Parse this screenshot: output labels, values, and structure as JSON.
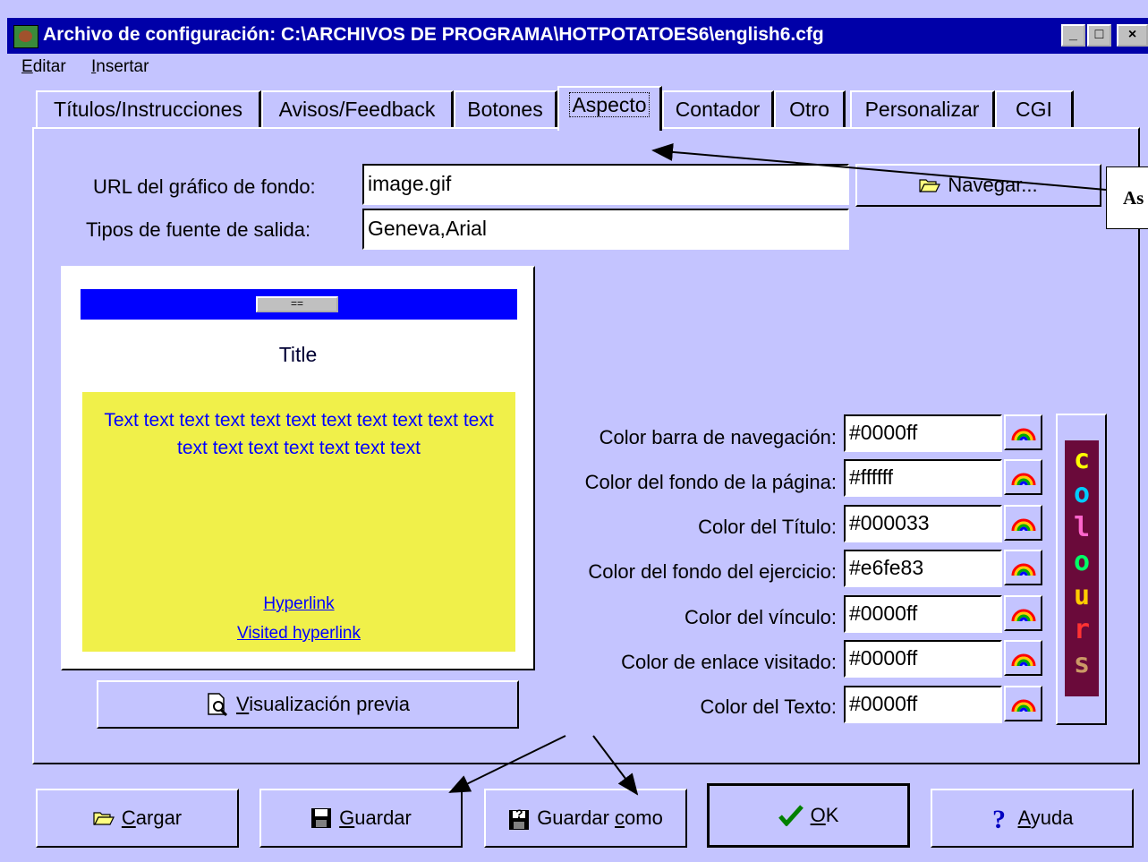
{
  "window": {
    "title": "Archivo de configuración: C:\\ARCHIVOS DE PROGRAMA\\HOTPOTATOES6\\english6.cfg",
    "minimize": "_",
    "maximize": "□",
    "close": "×"
  },
  "menu": {
    "editar_first": "E",
    "editar_rest": "ditar",
    "insertar_first": "I",
    "insertar_rest": "nsertar"
  },
  "tabs": [
    {
      "label": "Títulos/Instrucciones"
    },
    {
      "label": "Avisos/Feedback"
    },
    {
      "label": "Botones"
    },
    {
      "label": "Aspecto"
    },
    {
      "label": "Contador"
    },
    {
      "label": "Otro"
    },
    {
      "label": "Personalizar"
    },
    {
      "label": "CGI"
    }
  ],
  "form": {
    "bg_url_label": "URL del gráfico de fondo:",
    "bg_url_value": "image.gif",
    "browse_label": "Navegar...",
    "font_label": "Tipos de fuente de salida:",
    "font_value": "Geneva,Arial"
  },
  "preview": {
    "nav_button": "==",
    "title": "Title",
    "text": "Text text text text text text text text text text text text text text text text text text",
    "hyperlink": "Hyperlink",
    "visited": "Visited hyperlink",
    "button_first": "V",
    "button_rest": "isualización previa"
  },
  "colors": [
    {
      "label": "Color barra de navegación:",
      "value": "#0000ff"
    },
    {
      "label": "Color del fondo de la página:",
      "value": "#ffffff"
    },
    {
      "label": "Color del Título:",
      "value": "#000033"
    },
    {
      "label": "Color del fondo del ejercicio:",
      "value": "#e6fe83"
    },
    {
      "label": "Color del vínculo:",
      "value": "#0000ff"
    },
    {
      "label": "Color de enlace visitado:",
      "value": "#0000ff"
    },
    {
      "label": "Color del Texto:",
      "value": "#0000ff"
    }
  ],
  "colours_letters": [
    "c",
    "o",
    "l",
    "o",
    "u",
    "r",
    "s"
  ],
  "bottom_buttons": {
    "cargar_first": "C",
    "cargar_rest": "argar",
    "guardar_first": "G",
    "guardar_rest": "uardar",
    "guardar_como_a": "Guardar ",
    "guardar_como_b": "c",
    "guardar_como_c": "omo",
    "ok_first": "O",
    "ok_rest": "K",
    "ayuda_first": "A",
    "ayuda_rest": "yuda"
  },
  "callout": {
    "text": "As"
  },
  "theme": {
    "background": "#c4c4ff",
    "titlebar": "#0000a8",
    "preview_nav": "#0000ff",
    "preview_exercise": "#f0f04a"
  }
}
